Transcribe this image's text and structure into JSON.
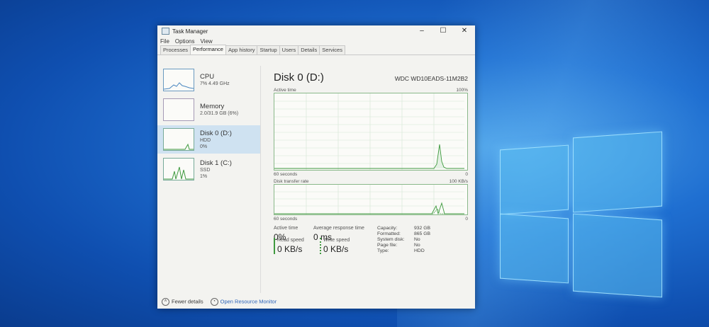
{
  "window": {
    "title": "Task Manager",
    "minimize": "–",
    "maximize": "☐",
    "close": "✕"
  },
  "menu": [
    "File",
    "Options",
    "View"
  ],
  "tabs": [
    "Processes",
    "Performance",
    "App history",
    "Startup",
    "Users",
    "Details",
    "Services"
  ],
  "sidebar": {
    "items": [
      {
        "name": "CPU",
        "line1": "7% 4.49 GHz",
        "line2": ""
      },
      {
        "name": "Memory",
        "line1": "2.0/31.9 GB (6%)",
        "line2": ""
      },
      {
        "name": "Disk 0 (D:)",
        "line1": "HDD",
        "line2": "0%"
      },
      {
        "name": "Disk 1 (C:)",
        "line1": "SSD",
        "line2": "1%"
      }
    ]
  },
  "main": {
    "title": "Disk 0 (D:)",
    "model": "WDC WD10EADS-11M2B2",
    "graph1": {
      "label": "Active time",
      "max": "100%",
      "time": "60 seconds",
      "min": "0"
    },
    "graph2": {
      "label": "Disk transfer rate",
      "max": "100 KB/s",
      "time": "60 seconds",
      "min": "0"
    },
    "active_time": {
      "label": "Active time",
      "value": "0%"
    },
    "avg_response": {
      "label": "Average response time",
      "value": "0 ms"
    },
    "read_speed": {
      "label": "Read speed",
      "value": "0 KB/s"
    },
    "write_speed": {
      "label": "Write speed",
      "value": "0 KB/s"
    },
    "props": [
      {
        "k": "Capacity:",
        "v": "932 GB"
      },
      {
        "k": "Formatted:",
        "v": "865 GB"
      },
      {
        "k": "System disk:",
        "v": "No"
      },
      {
        "k": "Page file:",
        "v": "No"
      },
      {
        "k": "Type:",
        "v": "HDD"
      }
    ]
  },
  "footer": {
    "fewer_details": "Fewer details",
    "resource_monitor": "Open Resource Monitor"
  },
  "colors": {
    "disk_graph": "#3f9a3f",
    "selected": "#cfe2f1",
    "link": "#2a62b8"
  }
}
